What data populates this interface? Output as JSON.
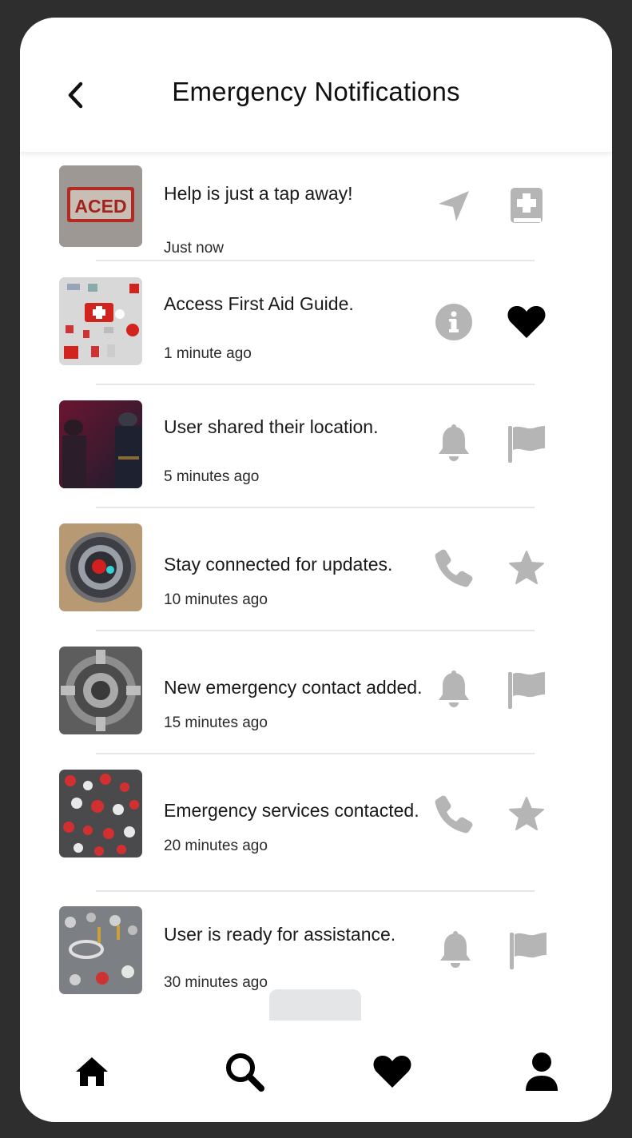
{
  "header": {
    "title": "Emergency Notifications"
  },
  "colors": {
    "muted_icon": "#b5b5b5",
    "active_icon": "#000000",
    "text": "#1a1a1a"
  },
  "notifications": [
    {
      "message": "Help is just a tap away!",
      "time": "Just now",
      "thumb": "aced-sign",
      "icons": [
        "navigation-arrow-icon",
        "first-aid-book-icon"
      ]
    },
    {
      "message": "Access First Aid Guide.",
      "time": "1 minute ago",
      "thumb": "first-aid-kit",
      "icons": [
        "info-icon",
        "heart-icon"
      ]
    },
    {
      "message": "User shared their location.",
      "time": "5 minutes ago",
      "thumb": "firefighters",
      "icons": [
        "bell-icon",
        "flag-icon"
      ]
    },
    {
      "message": "Stay connected for updates.",
      "time": "10 minutes ago",
      "thumb": "speaker-device",
      "icons": [
        "phone-icon",
        "star-icon"
      ]
    },
    {
      "message": "New emergency contact added.",
      "time": "15 minutes ago",
      "thumb": "metal-gear",
      "icons": [
        "bell-icon",
        "flag-icon"
      ]
    },
    {
      "message": "Emergency services contacted.",
      "time": "20 minutes ago",
      "thumb": "red-badges",
      "icons": [
        "phone-icon",
        "star-icon"
      ]
    },
    {
      "message": "User is ready for assistance.",
      "time": "30 minutes ago",
      "thumb": "circuit-figures",
      "icons": [
        "bell-icon",
        "flag-icon"
      ]
    }
  ],
  "thumbnail_text": {
    "aced": "ACED"
  },
  "tabbar": {
    "items": [
      "home-icon",
      "search-icon",
      "heart-icon",
      "profile-icon"
    ]
  }
}
